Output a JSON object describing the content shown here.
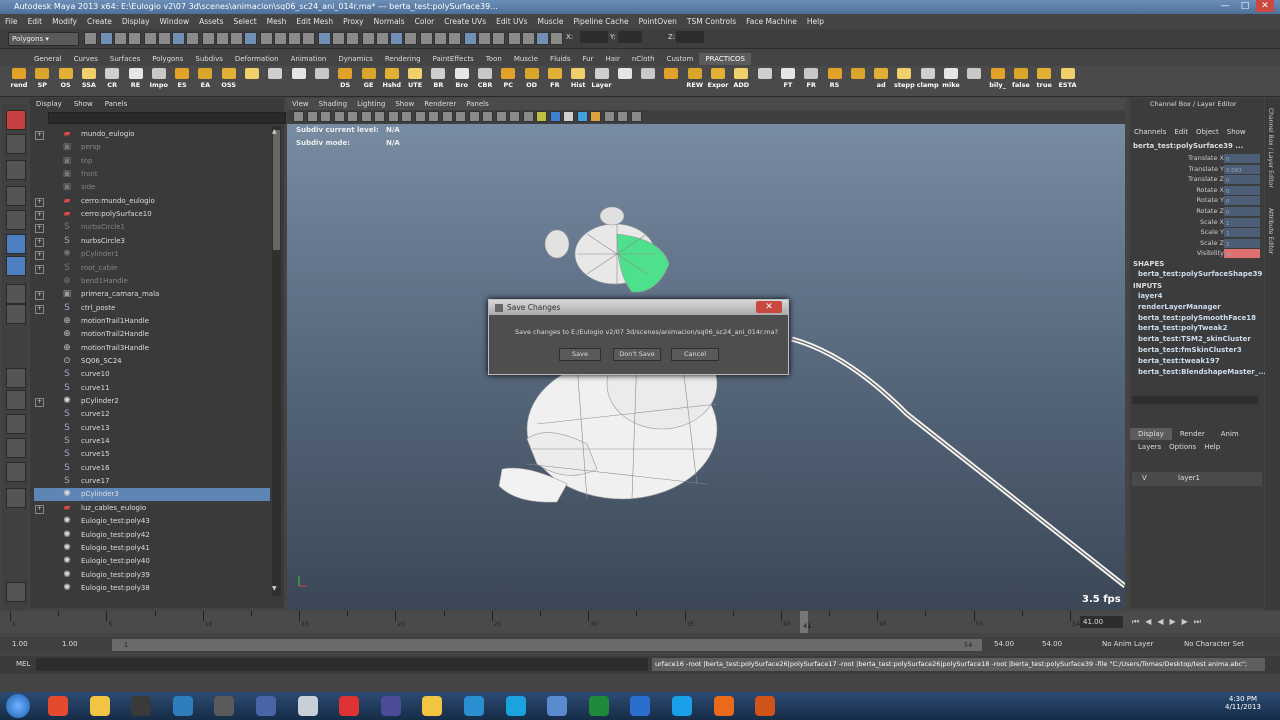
{
  "window": {
    "title": "Autodesk Maya 2013 x64: E:\\Eulogio v2\\07 3d\\scenes\\animacion\\sq06_sc24_ani_014r.ma*   ---   berta_test:polySurface39..."
  },
  "menubar": [
    "File",
    "Edit",
    "Modify",
    "Create",
    "Display",
    "Window",
    "Assets",
    "Select",
    "Mesh",
    "Edit Mesh",
    "Proxy",
    "Normals",
    "Color",
    "Create UVs",
    "Edit UVs",
    "Muscle",
    "Pipeline Cache",
    "PointOven",
    "TSM Controls",
    "Face Machine",
    "Help"
  ],
  "statusline": {
    "mode": "Polygons",
    "x_label": "X:",
    "y_label": "Y:",
    "z_label": "Z:"
  },
  "shelf_tabs": [
    "General",
    "Curves",
    "Surfaces",
    "Polygons",
    "Subdivs",
    "Deformation",
    "Animation",
    "Dynamics",
    "Rendering",
    "PaintEffects",
    "Toon",
    "Muscle",
    "Fluids",
    "Fur",
    "Hair",
    "nCloth",
    "Custom",
    "PRACTICOS"
  ],
  "shelf_buttons": [
    "rend",
    "SP",
    "OS",
    "SSA",
    "CR",
    "RE",
    "Impo",
    "ES",
    "EA",
    "OSS",
    "",
    "",
    "",
    "",
    "DS",
    "GE",
    "Hshd",
    "UTE",
    "BR",
    "Bro",
    "CBR",
    "PC",
    "OD",
    "FR",
    "Hist",
    "Layer",
    "",
    "",
    "",
    "REW",
    "Expor",
    "ADD",
    "",
    "FT",
    "FR",
    "RS",
    "",
    "ad",
    "stepp",
    "clamp",
    "mike",
    "",
    "bily_",
    "false",
    "true",
    "ESTA"
  ],
  "outliner": {
    "menu": [
      "Display",
      "Show",
      "Panels"
    ],
    "rows": [
      {
        "label": "mundo_eulogio",
        "icon": "transform",
        "expand": true,
        "dim": false
      },
      {
        "label": "persp",
        "icon": "camera",
        "expand": false,
        "dim": true
      },
      {
        "label": "top",
        "icon": "camera",
        "expand": false,
        "dim": true
      },
      {
        "label": "front",
        "icon": "camera",
        "expand": false,
        "dim": true
      },
      {
        "label": "side",
        "icon": "camera",
        "expand": false,
        "dim": true
      },
      {
        "label": "cerro:mundo_eulogio",
        "icon": "transform",
        "expand": true,
        "dim": false
      },
      {
        "label": "cerro:polySurface10",
        "icon": "transform",
        "expand": true,
        "dim": false
      },
      {
        "label": "nurbsCircle1",
        "icon": "curve",
        "expand": true,
        "dim": true
      },
      {
        "label": "nurbsCircle3",
        "icon": "curve",
        "expand": true,
        "dim": false
      },
      {
        "label": "pCylinder1",
        "icon": "mesh",
        "expand": true,
        "dim": true
      },
      {
        "label": "root_cable",
        "icon": "curve",
        "expand": true,
        "dim": true
      },
      {
        "label": "bend1Handle",
        "icon": "handle",
        "expand": false,
        "dim": true
      },
      {
        "label": "primera_camara_mala",
        "icon": "camera",
        "expand": true,
        "dim": false
      },
      {
        "label": "ctrl_poste",
        "icon": "curve",
        "expand": true,
        "dim": false
      },
      {
        "label": "motionTrail1Handle",
        "icon": "handle",
        "expand": false,
        "dim": false
      },
      {
        "label": "motionTrail2Handle",
        "icon": "handle",
        "expand": false,
        "dim": false
      },
      {
        "label": "motionTrail3Handle",
        "icon": "handle",
        "expand": false,
        "dim": false
      },
      {
        "label": "SQ06_SC24",
        "icon": "set",
        "expand": false,
        "dim": false
      },
      {
        "label": "curve10",
        "icon": "curve",
        "expand": false,
        "dim": false
      },
      {
        "label": "curve11",
        "icon": "curve",
        "expand": false,
        "dim": false
      },
      {
        "label": "pCylinder2",
        "icon": "mesh",
        "expand": true,
        "dim": false
      },
      {
        "label": "curve12",
        "icon": "curve",
        "expand": false,
        "dim": false
      },
      {
        "label": "curve13",
        "icon": "curve",
        "expand": false,
        "dim": false
      },
      {
        "label": "curve14",
        "icon": "curve",
        "expand": false,
        "dim": false
      },
      {
        "label": "curve15",
        "icon": "curve",
        "expand": false,
        "dim": false
      },
      {
        "label": "curve16",
        "icon": "curve",
        "expand": false,
        "dim": false
      },
      {
        "label": "curve17",
        "icon": "curve",
        "expand": false,
        "dim": false
      },
      {
        "label": "pCylinder3",
        "icon": "mesh",
        "expand": false,
        "dim": false,
        "selected": true
      },
      {
        "label": "luz_cables_eulogio",
        "icon": "transform",
        "expand": true,
        "dim": false
      },
      {
        "label": "Eulogio_test:poly43",
        "icon": "mesh",
        "expand": false,
        "dim": false
      },
      {
        "label": "Eulogio_test:poly42",
        "icon": "mesh",
        "expand": false,
        "dim": false
      },
      {
        "label": "Eulogio_test:poly41",
        "icon": "mesh",
        "expand": false,
        "dim": false
      },
      {
        "label": "Eulogio_test:poly40",
        "icon": "mesh",
        "expand": false,
        "dim": false
      },
      {
        "label": "Eulogio_test:poly39",
        "icon": "mesh",
        "expand": false,
        "dim": false
      },
      {
        "label": "Eulogio_test:poly38",
        "icon": "mesh",
        "expand": false,
        "dim": false
      }
    ]
  },
  "viewport": {
    "menu": [
      "View",
      "Shading",
      "Lighting",
      "Show",
      "Renderer",
      "Panels"
    ],
    "hud_level_label": "Subdiv current level:",
    "hud_level_value": "N/A",
    "hud_mode_label": "Subdiv mode:",
    "hud_mode_value": "N/A",
    "fps": "3.5 fps"
  },
  "dialog": {
    "title": "Save Changes",
    "message": "Save changes to E:/Eulogio v2/07 3d/scenes/animacion/sq06_sc24_ani_014r.ma?",
    "save": "Save",
    "dont_save": "Don't Save",
    "cancel": "Cancel"
  },
  "channelbox": {
    "header": "Channel Box / Layer Editor",
    "menu": [
      "Channels",
      "Edit",
      "Object",
      "Show"
    ],
    "object": "berta_test:polySurface39 ...",
    "attrs": [
      "Translate X",
      "Translate Y",
      "Translate Z",
      "Rotate X",
      "Rotate Y",
      "Rotate Z",
      "Scale X",
      "Scale Y",
      "Scale Z",
      "Visibility"
    ],
    "values": [
      "0",
      "0.093",
      "0",
      "0",
      "0",
      "0",
      "1",
      "1",
      "1",
      "on"
    ],
    "shapes_label": "SHAPES",
    "shapes": [
      "berta_test:polySurfaceShape39"
    ],
    "inputs_label": "INPUTS",
    "inputs": [
      "layer4",
      "renderLayerManager",
      "berta_test:polySmoothFace18",
      "berta_test:polyTweak2",
      "berta_test:TSM2_skinCluster",
      "berta_test:fmSkinCluster3",
      "berta_test:tweak197",
      "berta_test:BlendshapeMaster_..."
    ],
    "layer_tabs": [
      "Display",
      "Render",
      "Anim"
    ],
    "layer_menu": [
      "Layers",
      "Options",
      "Help"
    ],
    "layer_v": "V",
    "layer_name": "layer1",
    "side_tabs": [
      "Channel Box / Layer Editor",
      "Attribute Editor"
    ]
  },
  "timeline": {
    "current": "41",
    "end": "41.00",
    "ticks": [
      "1",
      "",
      "5",
      "",
      "10",
      "",
      "15",
      "",
      "20",
      "",
      "25",
      "",
      "30",
      "",
      "35",
      "",
      "40",
      "",
      "45",
      "",
      "50",
      "",
      "54"
    ]
  },
  "range": {
    "start": "1.00",
    "inner_start": "1.00",
    "slider_start": "1",
    "slider_end": "54",
    "inner_end": "54.00",
    "end": "54.00",
    "anim_layer": "No Anim Layer",
    "char_set": "No Character Set"
  },
  "cmdline": {
    "label": "MEL",
    "output": "urface16 -root |berta_test:polySurface26|polySurface17 -root |berta_test:polySurface26|polySurface18 -root |berta_test:polySurface39 -file \"C:/Users/Tomas/Desktop/test anima.abc\";"
  },
  "taskbar": {
    "time": "4:30 PM",
    "date": "4/11/2013"
  },
  "colors": {
    "selection": "#5d86b5",
    "accent_red": "#c9483f",
    "shelf_active": "#5c5c5c"
  }
}
